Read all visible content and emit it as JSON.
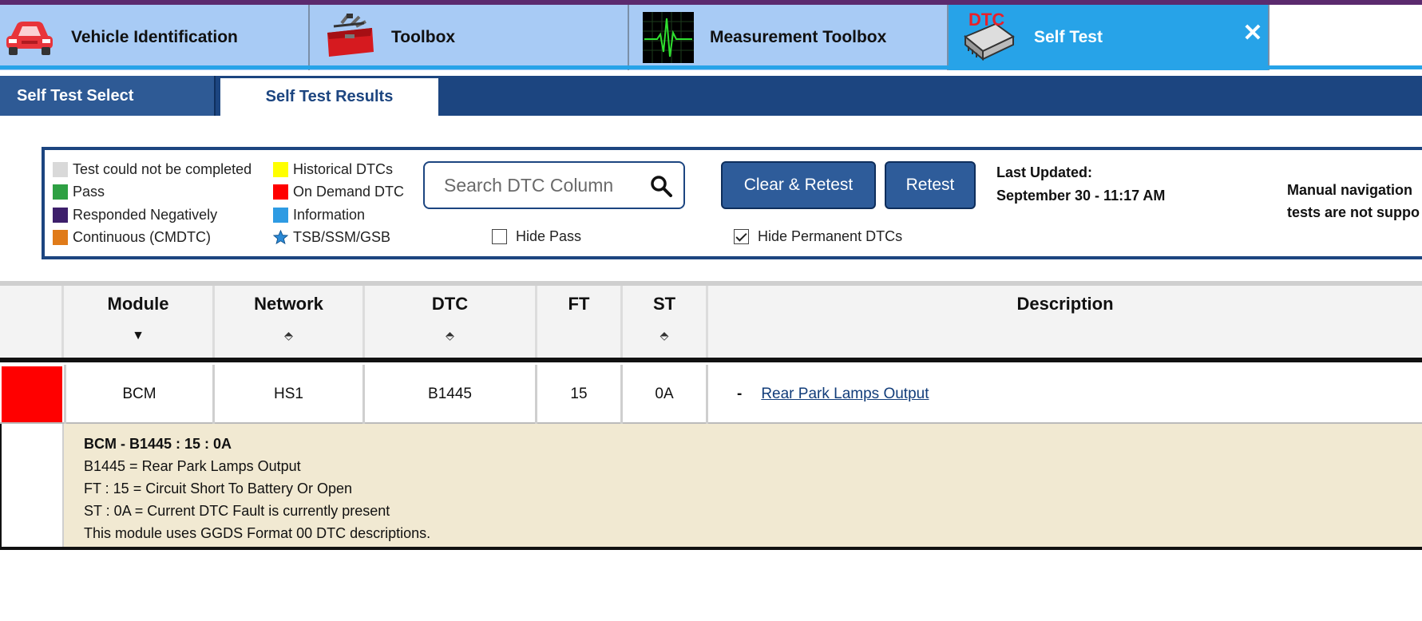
{
  "main_tabs": [
    {
      "label": "Vehicle Identification",
      "icon": "car-icon",
      "active": false
    },
    {
      "label": "Toolbox",
      "icon": "toolbox-icon",
      "active": false
    },
    {
      "label": "Measurement Toolbox",
      "icon": "waveform-icon",
      "active": false
    },
    {
      "label": "Self Test",
      "icon": "dtc-module-icon",
      "icon_text": "DTC",
      "active": true
    }
  ],
  "sub_tabs": [
    {
      "label": "Self Test Select",
      "active": false
    },
    {
      "label": "Self Test Results",
      "active": true
    }
  ],
  "legend": {
    "col1": [
      {
        "label": "Test could not be completed",
        "color": "#d9d9d9"
      },
      {
        "label": "Pass",
        "color": "#2ea043"
      },
      {
        "label": "Responded Negatively",
        "color": "#3d1f6b"
      },
      {
        "label": "Continuous (CMDTC)",
        "color": "#e07b1a"
      }
    ],
    "col2": [
      {
        "label": "Historical DTCs",
        "color": "#ffff00"
      },
      {
        "label": "On Demand DTC",
        "color": "#ff0000"
      },
      {
        "label": "Information",
        "color": "#2e9be3"
      },
      {
        "label": "TSB/SSM/GSB",
        "icon": "star-icon"
      }
    ]
  },
  "search": {
    "placeholder": "Search DTC Column"
  },
  "buttons": {
    "clear_retest": "Clear & Retest",
    "retest": "Retest"
  },
  "filters": {
    "hide_pass": {
      "label": "Hide Pass",
      "checked": false
    },
    "hide_permanent": {
      "label": "Hide Permanent DTCs",
      "checked": true
    }
  },
  "last_updated": {
    "label": "Last Updated:",
    "value": "September 30 - 11:17 AM"
  },
  "manual_note": {
    "line1": "Manual navigation",
    "line2": "tests are not suppo"
  },
  "table": {
    "headers": [
      "Module",
      "Network",
      "DTC",
      "FT",
      "ST",
      "Description"
    ],
    "rows": [
      {
        "status_color": "#ff0000",
        "module": "BCM",
        "network": "HS1",
        "dtc": "B1445",
        "ft": "15",
        "st": "0A",
        "dash": "-",
        "description": "Rear Park Lamps Output"
      }
    ]
  },
  "detail": {
    "title": "BCM - B1445 : 15 : 0A",
    "lines": [
      "B1445 = Rear Park Lamps Output",
      "FT : 15 = Circuit Short To Battery Or Open",
      "ST : 0A = Current DTC Fault is currently present",
      "This module uses GGDS Format 00 DTC descriptions."
    ]
  }
}
